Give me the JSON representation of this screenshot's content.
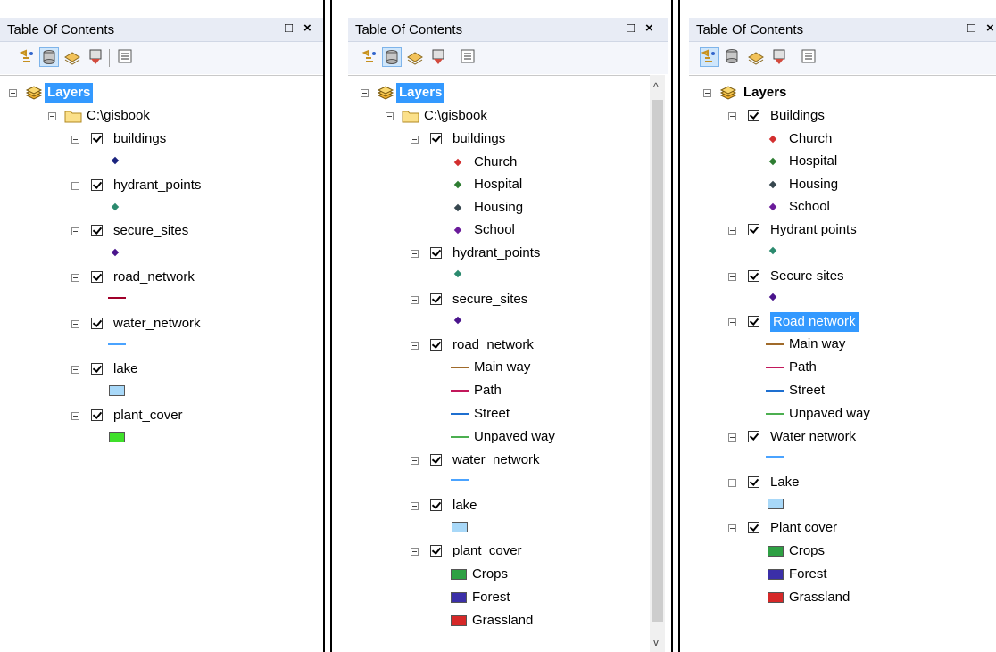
{
  "window": {
    "title": "Table Of Contents",
    "restore_icon": "□",
    "close_icon": "×"
  },
  "colors": {
    "titlebar": "#e8ecf5",
    "selection": "#3399ff",
    "dot_building": "#1a237e",
    "dot_church": "#d32f2f",
    "dot_hospital": "#2e7d32",
    "dot_housing": "#37474f",
    "dot_school": "#6a1b9a",
    "dot_hydrant": "#2b8a6e",
    "dot_secure": "#4a148c",
    "line_road": "#a0002a",
    "line_main": "#a06a2a",
    "line_path": "#c2185b",
    "line_street": "#1e6fd0",
    "line_water": "#4aa3ff",
    "line_unpaved": "#4caf50",
    "fill_lake": "#a8d8f8",
    "fill_plant": "#3fe02a",
    "fill_crops": "#2ea043",
    "fill_forest": "#3b2fa8",
    "fill_grassland": "#d62828"
  },
  "panel1": {
    "layers": "Layers",
    "folder": "C:\\gisbook",
    "buildings": "buildings",
    "hydrant_points": "hydrant_points",
    "secure_sites": "secure_sites",
    "road_network": "road_network",
    "water_network": "water_network",
    "lake": "lake",
    "plant_cover": "plant_cover"
  },
  "panel2": {
    "layers": "Layers",
    "folder": "C:\\gisbook",
    "buildings": "buildings",
    "church": "Church",
    "hospital": "Hospital",
    "housing": "Housing",
    "school": "School",
    "hydrant_points": "hydrant_points",
    "secure_sites": "secure_sites",
    "road_network": "road_network",
    "main_way": "Main way",
    "path": "Path",
    "street": "Street",
    "unpaved_way": "Unpaved way",
    "water_network": "water_network",
    "lake": "lake",
    "plant_cover": "plant_cover",
    "crops": "Crops",
    "forest": "Forest",
    "grassland": "Grassland",
    "scroll_up": "^",
    "scroll_down": "v"
  },
  "panel3": {
    "layers": "Layers",
    "buildings": "Buildings",
    "church": "Church",
    "hospital": "Hospital",
    "housing": "Housing",
    "school": "School",
    "hydrant_points": "Hydrant points",
    "secure_sites": "Secure sites",
    "road_network": "Road network",
    "main_way": "Main way",
    "path": "Path",
    "street": "Street",
    "unpaved_way": "Unpaved way",
    "water_network": "Water network",
    "lake": "Lake",
    "plant_cover": "Plant cover",
    "crops": "Crops",
    "forest": "Forest",
    "grassland": "Grassland"
  }
}
